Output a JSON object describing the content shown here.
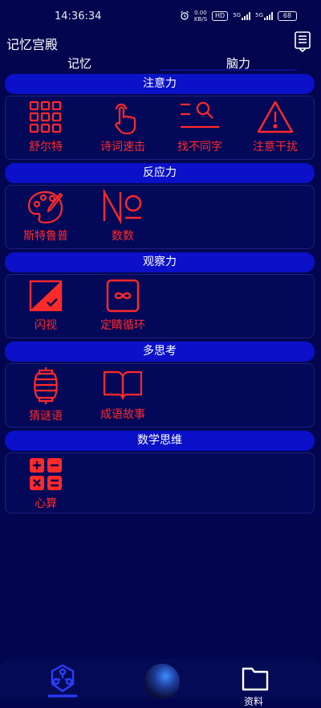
{
  "status_bar": {
    "time": "14:36:34",
    "net_speed": "0.00",
    "net_unit": "KB/S",
    "hd_label": "HD",
    "sim1": "5G",
    "sim2": "5G",
    "battery": "68"
  },
  "header": {
    "title": "记忆宫殿",
    "menu_icon": "clipboard-list-icon"
  },
  "tabs": [
    {
      "label": "记忆"
    },
    {
      "label": "脑力",
      "active": true
    }
  ],
  "sections": [
    {
      "title": "注意力",
      "items": [
        {
          "label": "舒尔特",
          "icon": "grid-icon"
        },
        {
          "label": "诗词速击",
          "icon": "tap-hand-icon"
        },
        {
          "label": "找不同字",
          "icon": "search-lines-icon"
        },
        {
          "label": "注意干扰",
          "icon": "warning-triangle-icon"
        }
      ]
    },
    {
      "title": "反应力",
      "items": [
        {
          "label": "斯特鲁普",
          "icon": "palette-icon"
        },
        {
          "label": "数数",
          "icon": "numero-icon"
        }
      ]
    },
    {
      "title": "观察力",
      "items": [
        {
          "label": "闪视",
          "icon": "flash-view-icon"
        },
        {
          "label": "定睛循环",
          "icon": "infinity-box-icon"
        }
      ]
    },
    {
      "title": "多思考",
      "items": [
        {
          "label": "猜谜语",
          "icon": "lantern-icon"
        },
        {
          "label": "成语故事",
          "icon": "open-book-icon"
        }
      ]
    },
    {
      "title": "数学思维",
      "items": [
        {
          "label": "心算",
          "icon": "calculator-icon"
        }
      ]
    }
  ],
  "bottom_nav": {
    "left_icon": "network-shield-icon",
    "center_icon": "avatar-icon",
    "right_icon": "folder-icon",
    "right_label": "资料"
  },
  "colors": {
    "background": "#03064e",
    "section_header": "#0a11c9",
    "accent_red": "#ff2a2a"
  }
}
